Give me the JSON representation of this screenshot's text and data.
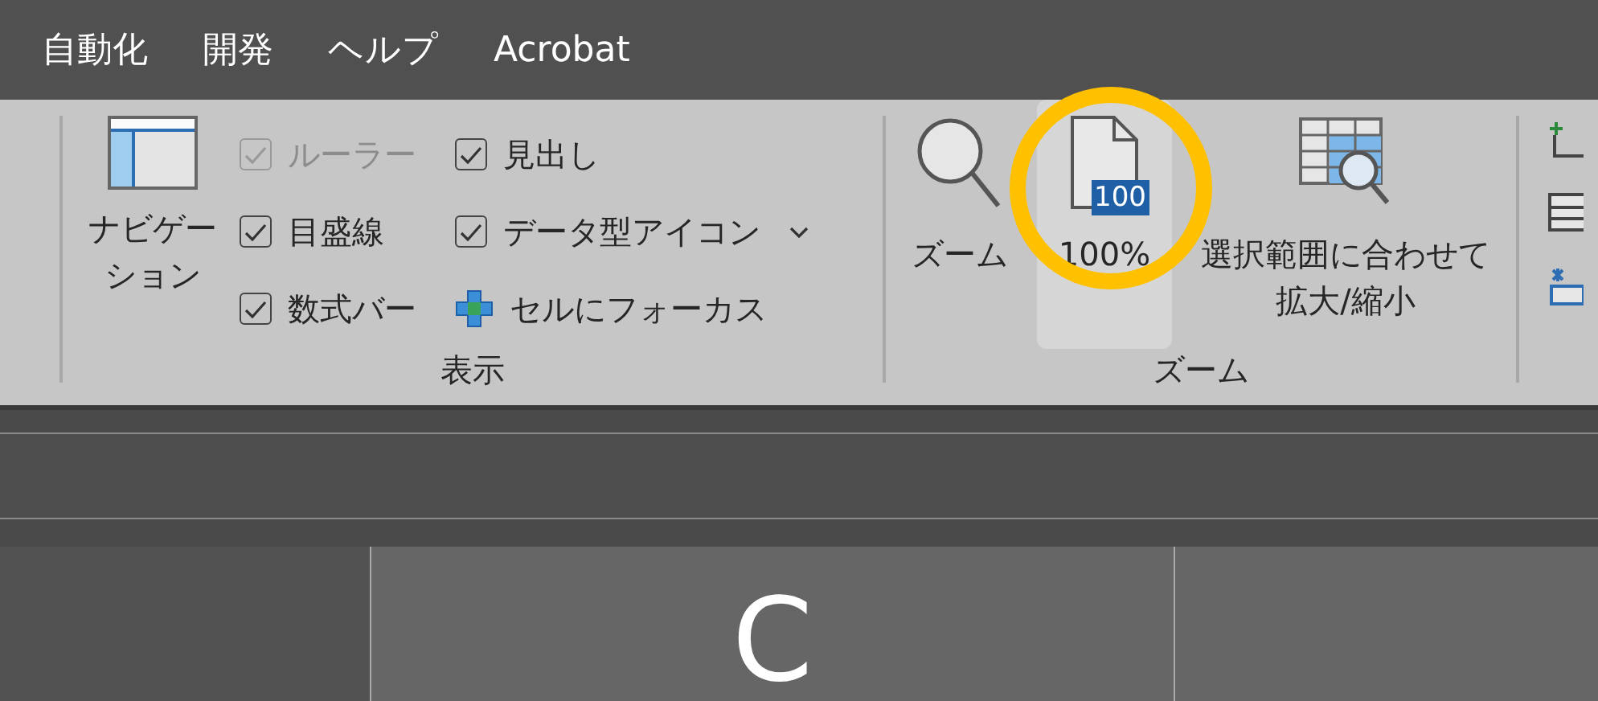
{
  "menu_tabs": [
    {
      "label": "自動化"
    },
    {
      "label": "開発"
    },
    {
      "label": "ヘルプ"
    },
    {
      "label": "Acrobat"
    }
  ],
  "view_group": {
    "title": "表示",
    "navigation": {
      "label_lines": [
        "ナビゲー",
        "ション"
      ]
    },
    "options": [
      {
        "kind": "checkbox",
        "label": "ルーラー",
        "checked": true,
        "disabled": true
      },
      {
        "kind": "checkbox",
        "label": "目盛線",
        "checked": true,
        "disabled": false
      },
      {
        "kind": "checkbox",
        "label": "数式バー",
        "checked": true,
        "disabled": false
      },
      {
        "kind": "checkbox",
        "label": "見出し",
        "checked": true,
        "disabled": false
      },
      {
        "kind": "checkbox",
        "label": "データ型アイコン",
        "checked": true,
        "disabled": false
      },
      {
        "kind": "focus",
        "label": "セルにフォーカス"
      }
    ]
  },
  "zoom_group": {
    "title": "ズーム",
    "buttons": [
      {
        "kind": "magnifier",
        "label_lines": [
          "ズーム"
        ],
        "selected": false
      },
      {
        "kind": "page",
        "badge": "100",
        "label_lines": [
          "100%"
        ],
        "selected": true
      },
      {
        "kind": "fit",
        "label_lines": [
          "選択範囲に合わせて",
          "拡大/縮小"
        ],
        "selected": false
      }
    ]
  },
  "annotation": {
    "kind": "circle",
    "color": "#ffc000"
  },
  "columns": [
    {
      "selected": false
    },
    {
      "label": "C",
      "selected": true
    },
    {
      "selected": true
    }
  ]
}
